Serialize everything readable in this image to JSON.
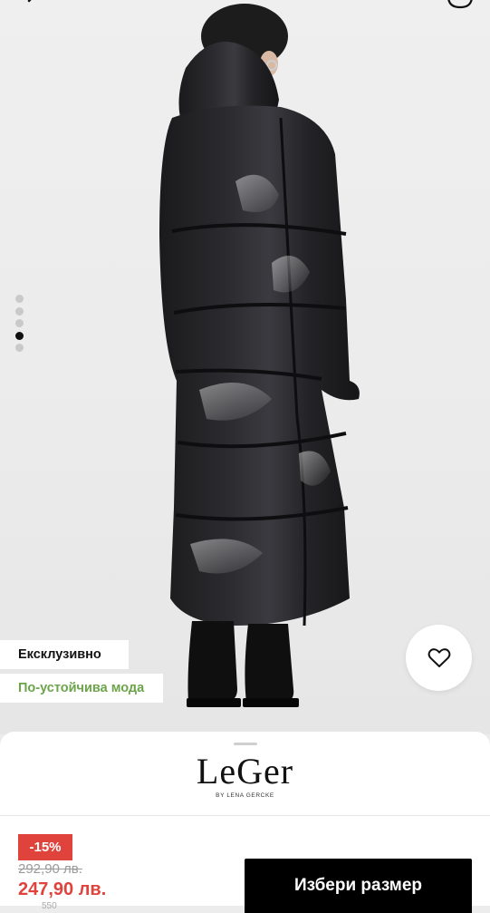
{
  "badges": {
    "exclusive": "Ексклузивно",
    "sustainable": "По-устойчива мода"
  },
  "gallery": {
    "image_count": 5,
    "active_index": 3
  },
  "brand": {
    "name": "LeGer",
    "subtitle": "BY LENA GERCKE"
  },
  "price": {
    "discount": "-15%",
    "original": "292,90 лв.",
    "current": "247,90 лв.",
    "below": "550"
  },
  "actions": {
    "select_size": "Избери размер"
  },
  "icons": {
    "back": "chevron-left-icon",
    "share": "share-icon",
    "favorite": "heart-outline-icon"
  },
  "colors": {
    "discount": "#e0423c",
    "sustainable": "#6ba44a",
    "button": "#000000"
  }
}
